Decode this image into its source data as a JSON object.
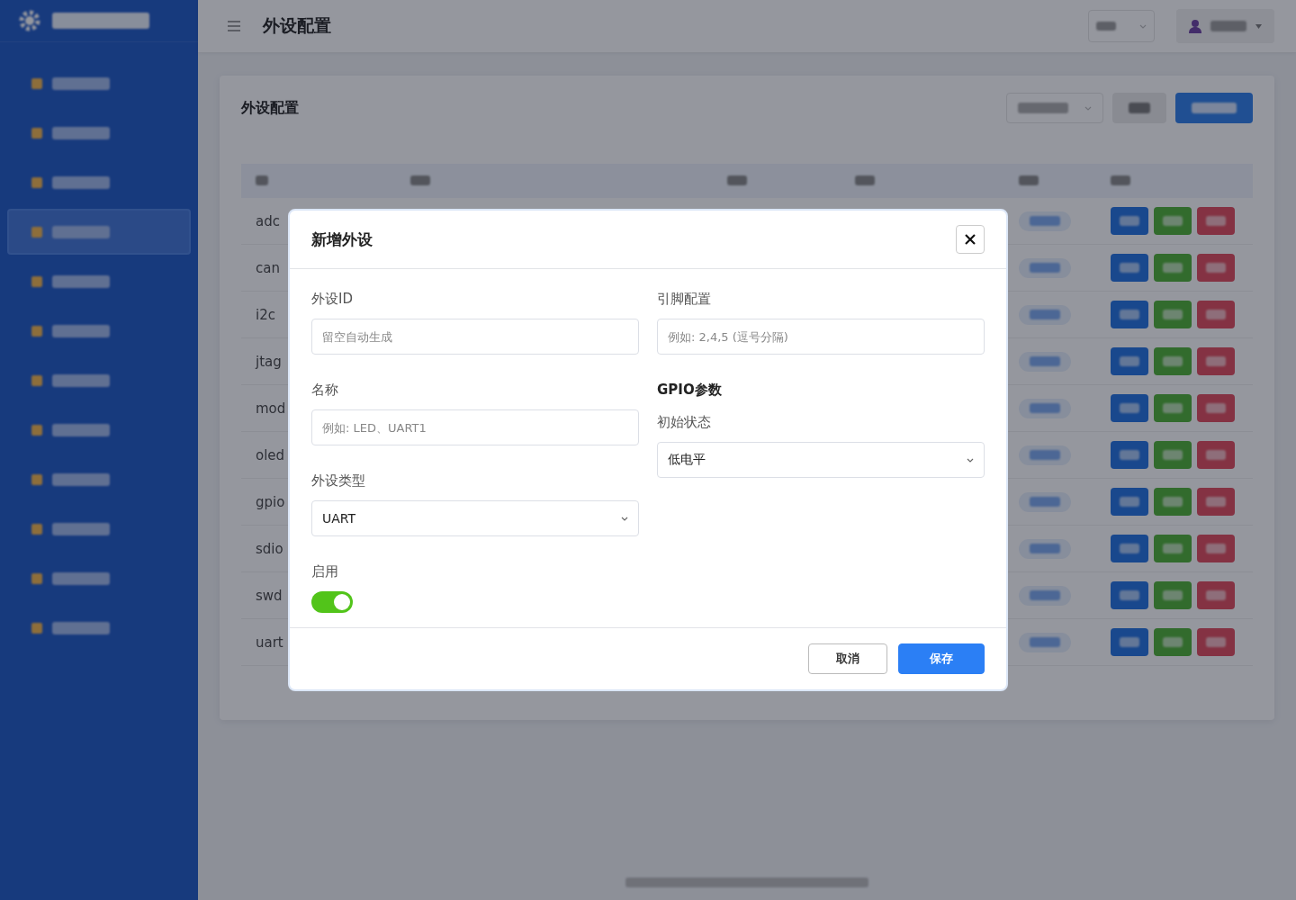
{
  "sidebar": {
    "items": [
      {
        "selected": false
      },
      {
        "selected": false
      },
      {
        "selected": false
      },
      {
        "selected": true
      },
      {
        "selected": false
      },
      {
        "selected": false
      },
      {
        "selected": false
      },
      {
        "selected": false
      },
      {
        "selected": false
      },
      {
        "selected": false
      },
      {
        "selected": false
      },
      {
        "selected": false
      }
    ]
  },
  "header": {
    "title": "外设配置"
  },
  "panel": {
    "title": "外设配置",
    "buttons": [
      {
        "kind": "secondary"
      },
      {
        "kind": "primary"
      }
    ],
    "table": {
      "rows": [
        {
          "id": "adc"
        },
        {
          "id": "can"
        },
        {
          "id": "i2c"
        },
        {
          "id": "jtag"
        },
        {
          "id": "mod"
        },
        {
          "id": "oled"
        },
        {
          "id": "gpio"
        },
        {
          "id": "sdio"
        },
        {
          "id": "swd"
        },
        {
          "id": "uart"
        }
      ]
    }
  },
  "dialog": {
    "title": "新增外设",
    "columns": [
      [
        {
          "kind": "input",
          "label": "外设ID",
          "placeholder": "留空自动生成"
        },
        {
          "kind": "input",
          "label": "名称",
          "placeholder": "例如: LED、UART1"
        },
        {
          "kind": "select",
          "label": "外设类型",
          "value": "UART"
        },
        {
          "kind": "switch",
          "label": "启用",
          "on": true
        }
      ],
      [
        {
          "kind": "input",
          "label": "引脚配置",
          "placeholder": "例如: 2,4,5 (逗号分隔)"
        },
        {
          "kind": "heading",
          "label": "GPIO参数"
        },
        {
          "kind": "select",
          "label": "初始状态",
          "value": "低电平"
        }
      ]
    ],
    "buttons": [
      {
        "label": "取消",
        "kind": "secondary"
      },
      {
        "label": "保存",
        "kind": "primary"
      }
    ]
  }
}
